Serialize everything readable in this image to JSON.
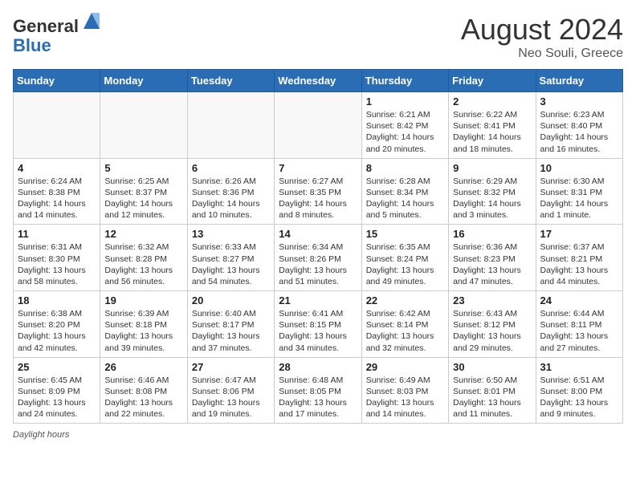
{
  "header": {
    "logo_line1": "General",
    "logo_line2": "Blue",
    "month_year": "August 2024",
    "location": "Neo Souli, Greece"
  },
  "days_of_week": [
    "Sunday",
    "Monday",
    "Tuesday",
    "Wednesday",
    "Thursday",
    "Friday",
    "Saturday"
  ],
  "weeks": [
    [
      {
        "day": "",
        "info": ""
      },
      {
        "day": "",
        "info": ""
      },
      {
        "day": "",
        "info": ""
      },
      {
        "day": "",
        "info": ""
      },
      {
        "day": "1",
        "sunrise": "6:21 AM",
        "sunset": "8:42 PM",
        "daylight": "14 hours and 20 minutes."
      },
      {
        "day": "2",
        "sunrise": "6:22 AM",
        "sunset": "8:41 PM",
        "daylight": "14 hours and 18 minutes."
      },
      {
        "day": "3",
        "sunrise": "6:23 AM",
        "sunset": "8:40 PM",
        "daylight": "14 hours and 16 minutes."
      }
    ],
    [
      {
        "day": "4",
        "sunrise": "6:24 AM",
        "sunset": "8:38 PM",
        "daylight": "14 hours and 14 minutes."
      },
      {
        "day": "5",
        "sunrise": "6:25 AM",
        "sunset": "8:37 PM",
        "daylight": "14 hours and 12 minutes."
      },
      {
        "day": "6",
        "sunrise": "6:26 AM",
        "sunset": "8:36 PM",
        "daylight": "14 hours and 10 minutes."
      },
      {
        "day": "7",
        "sunrise": "6:27 AM",
        "sunset": "8:35 PM",
        "daylight": "14 hours and 8 minutes."
      },
      {
        "day": "8",
        "sunrise": "6:28 AM",
        "sunset": "8:34 PM",
        "daylight": "14 hours and 5 minutes."
      },
      {
        "day": "9",
        "sunrise": "6:29 AM",
        "sunset": "8:32 PM",
        "daylight": "14 hours and 3 minutes."
      },
      {
        "day": "10",
        "sunrise": "6:30 AM",
        "sunset": "8:31 PM",
        "daylight": "14 hours and 1 minute."
      }
    ],
    [
      {
        "day": "11",
        "sunrise": "6:31 AM",
        "sunset": "8:30 PM",
        "daylight": "13 hours and 58 minutes."
      },
      {
        "day": "12",
        "sunrise": "6:32 AM",
        "sunset": "8:28 PM",
        "daylight": "13 hours and 56 minutes."
      },
      {
        "day": "13",
        "sunrise": "6:33 AM",
        "sunset": "8:27 PM",
        "daylight": "13 hours and 54 minutes."
      },
      {
        "day": "14",
        "sunrise": "6:34 AM",
        "sunset": "8:26 PM",
        "daylight": "13 hours and 51 minutes."
      },
      {
        "day": "15",
        "sunrise": "6:35 AM",
        "sunset": "8:24 PM",
        "daylight": "13 hours and 49 minutes."
      },
      {
        "day": "16",
        "sunrise": "6:36 AM",
        "sunset": "8:23 PM",
        "daylight": "13 hours and 47 minutes."
      },
      {
        "day": "17",
        "sunrise": "6:37 AM",
        "sunset": "8:21 PM",
        "daylight": "13 hours and 44 minutes."
      }
    ],
    [
      {
        "day": "18",
        "sunrise": "6:38 AM",
        "sunset": "8:20 PM",
        "daylight": "13 hours and 42 minutes."
      },
      {
        "day": "19",
        "sunrise": "6:39 AM",
        "sunset": "8:18 PM",
        "daylight": "13 hours and 39 minutes."
      },
      {
        "day": "20",
        "sunrise": "6:40 AM",
        "sunset": "8:17 PM",
        "daylight": "13 hours and 37 minutes."
      },
      {
        "day": "21",
        "sunrise": "6:41 AM",
        "sunset": "8:15 PM",
        "daylight": "13 hours and 34 minutes."
      },
      {
        "day": "22",
        "sunrise": "6:42 AM",
        "sunset": "8:14 PM",
        "daylight": "13 hours and 32 minutes."
      },
      {
        "day": "23",
        "sunrise": "6:43 AM",
        "sunset": "8:12 PM",
        "daylight": "13 hours and 29 minutes."
      },
      {
        "day": "24",
        "sunrise": "6:44 AM",
        "sunset": "8:11 PM",
        "daylight": "13 hours and 27 minutes."
      }
    ],
    [
      {
        "day": "25",
        "sunrise": "6:45 AM",
        "sunset": "8:09 PM",
        "daylight": "13 hours and 24 minutes."
      },
      {
        "day": "26",
        "sunrise": "6:46 AM",
        "sunset": "8:08 PM",
        "daylight": "13 hours and 22 minutes."
      },
      {
        "day": "27",
        "sunrise": "6:47 AM",
        "sunset": "8:06 PM",
        "daylight": "13 hours and 19 minutes."
      },
      {
        "day": "28",
        "sunrise": "6:48 AM",
        "sunset": "8:05 PM",
        "daylight": "13 hours and 17 minutes."
      },
      {
        "day": "29",
        "sunrise": "6:49 AM",
        "sunset": "8:03 PM",
        "daylight": "13 hours and 14 minutes."
      },
      {
        "day": "30",
        "sunrise": "6:50 AM",
        "sunset": "8:01 PM",
        "daylight": "13 hours and 11 minutes."
      },
      {
        "day": "31",
        "sunrise": "6:51 AM",
        "sunset": "8:00 PM",
        "daylight": "13 hours and 9 minutes."
      }
    ]
  ],
  "footer": {
    "note": "Daylight hours"
  }
}
